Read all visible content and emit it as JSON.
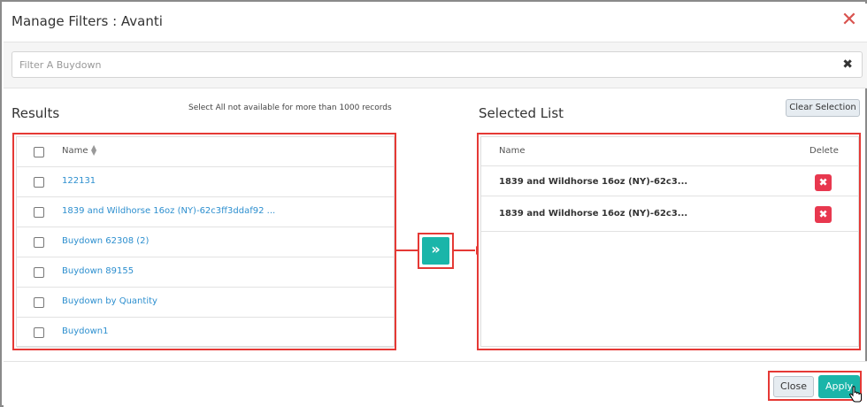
{
  "dialog": {
    "title": "Manage Filters : Avanti",
    "close_glyph": "✕"
  },
  "search": {
    "placeholder": "Filter A Buydown",
    "value": "",
    "clear_glyph": "✖"
  },
  "results": {
    "title": "Results",
    "note": "Select All not available for more than 1000 records",
    "header_label": "Name",
    "items": [
      {
        "label": "122131"
      },
      {
        "label": "1839 and Wildhorse 16oz (NY)-62c3ff3ddaf92 ..."
      },
      {
        "label": "Buydown 62308 (2)"
      },
      {
        "label": "Buydown 89155"
      },
      {
        "label": "Buydown by Quantity"
      },
      {
        "label": "Buydown1"
      }
    ]
  },
  "move_button": {
    "glyph": "»",
    "icon": "double-chevron-right-icon"
  },
  "selected": {
    "title": "Selected List",
    "clear_label": "Clear Selection",
    "header_name": "Name",
    "header_delete": "Delete",
    "items": [
      {
        "label": "1839 and Wildhorse 16oz (NY)-62c3..."
      },
      {
        "label": "1839 and Wildhorse 16oz (NY)-62c3..."
      }
    ],
    "delete_glyph": "✖"
  },
  "footer": {
    "close_label": "Close",
    "apply_label": "Apply"
  },
  "colors": {
    "accent": "#1ab5a9",
    "highlight": "#e53935",
    "link": "#2d8fcf",
    "delete": "#e8384f"
  }
}
